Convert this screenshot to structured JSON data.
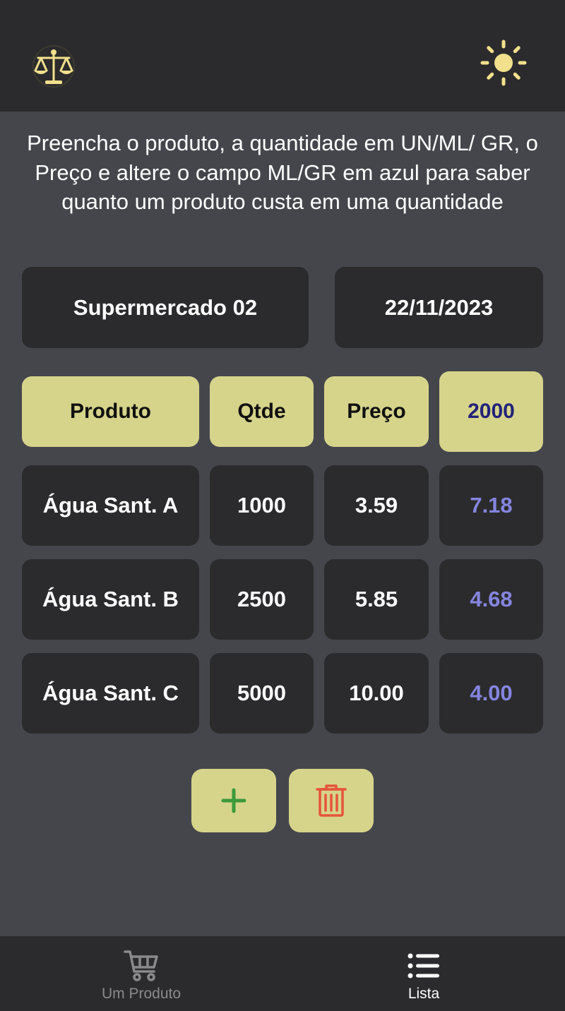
{
  "header": {
    "logo_icon": "balance-scale-icon",
    "theme_icon": "sun-icon",
    "accent_color": "#f2e08c"
  },
  "instructions": "Preencha o produto, a quantidade em UN/ML/ GR, o Preço e altere o campo ML/GR em azul para saber quanto um produto custa em uma quantidade",
  "store": {
    "name": "Supermercado 02",
    "date": "22/11/2023"
  },
  "table": {
    "headers": {
      "product": "Produto",
      "qty": "Qtde",
      "price": "Preço",
      "target_qty": "2000"
    },
    "rows": [
      {
        "product": "Água Sant. A",
        "qty": "1000",
        "price": "3.59",
        "result": "7.18"
      },
      {
        "product": "Água Sant. B",
        "qty": "2500",
        "price": "5.85",
        "result": "4.68"
      },
      {
        "product": "Água Sant. C",
        "qty": "5000",
        "price": "10.00",
        "result": "4.00"
      }
    ]
  },
  "actions": {
    "add_icon": "plus-icon",
    "delete_icon": "trash-icon"
  },
  "nav": {
    "items": [
      {
        "label": "Um Produto",
        "icon": "cart-icon",
        "active": false
      },
      {
        "label": "Lista",
        "icon": "list-icon",
        "active": true
      }
    ]
  },
  "colors": {
    "background": "#45464c",
    "card": "#2b2b2d",
    "header_cell": "#d6d48b",
    "target_text": "#22227a",
    "result_text": "#8585e0",
    "add_green": "#3b9a3b",
    "delete_red": "#e5553a"
  }
}
